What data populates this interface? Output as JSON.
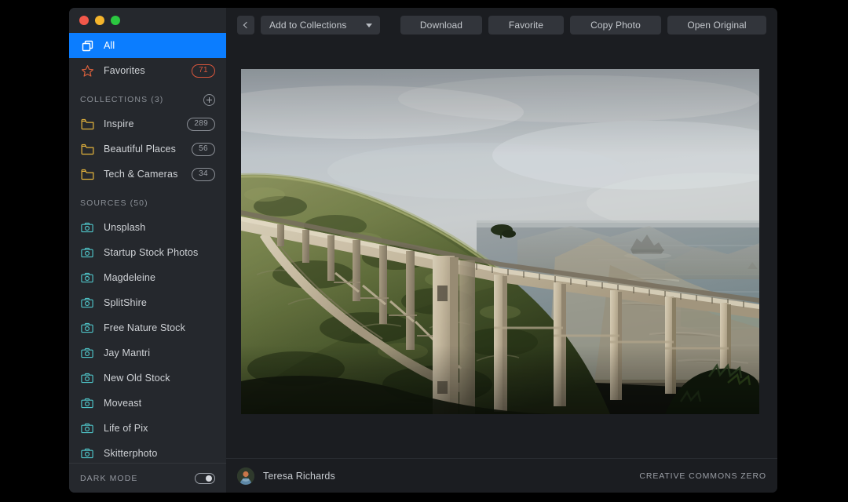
{
  "window": {
    "traffic_lights": [
      "close",
      "minimize",
      "maximize"
    ]
  },
  "sidebar": {
    "primary": [
      {
        "label": "All",
        "icon": "layers-icon",
        "badge": null,
        "active": true
      },
      {
        "label": "Favorites",
        "icon": "star-icon",
        "badge": "71",
        "active": false
      }
    ],
    "collections_header": "COLLECTIONS (3)",
    "add_collection_icon": "plus-circle-icon",
    "collections": [
      {
        "label": "Inspire",
        "icon": "folder-icon",
        "badge": "289"
      },
      {
        "label": "Beautiful Places",
        "icon": "folder-icon",
        "badge": "56"
      },
      {
        "label": "Tech & Cameras",
        "icon": "folder-icon",
        "badge": "34"
      }
    ],
    "sources_header": "SOURCES (50)",
    "sources": [
      {
        "label": "Unsplash",
        "icon": "camera-icon"
      },
      {
        "label": "Startup Stock Photos",
        "icon": "camera-icon"
      },
      {
        "label": "Magdeleine",
        "icon": "camera-icon"
      },
      {
        "label": "SplitShire",
        "icon": "camera-icon"
      },
      {
        "label": "Free Nature Stock",
        "icon": "camera-icon"
      },
      {
        "label": "Jay Mantri",
        "icon": "camera-icon"
      },
      {
        "label": "New Old Stock",
        "icon": "camera-icon"
      },
      {
        "label": "Moveast",
        "icon": "camera-icon"
      },
      {
        "label": "Life of Pix",
        "icon": "camera-icon"
      },
      {
        "label": "Skitterphoto",
        "icon": "camera-icon"
      }
    ],
    "dark_mode_label": "DARK MODE",
    "dark_mode_on": true
  },
  "toolbar": {
    "back_icon": "chevron-left-icon",
    "add_to_collections": "Add to Collections",
    "dropdown_icon": "caret-down-icon",
    "download": "Download",
    "favorite": "Favorite",
    "copy_photo": "Copy Photo",
    "open_original": "Open Original"
  },
  "photo": {
    "alt": "Bixby Creek Bridge on a green coastal hillside above the Pacific Ocean"
  },
  "statusbar": {
    "avatar_icon": "avatar",
    "author": "Teresa Richards",
    "license": "CREATIVE COMMONS ZERO"
  },
  "colors": {
    "accent": "#0b7dff",
    "sidebar_bg": "#25282d",
    "main_bg": "#1b1d21",
    "button_bg": "#32353b",
    "favorite_badge": "#d9563c",
    "folder_icon": "#e3b23c",
    "camera_icon": "#4fc4c8"
  }
}
